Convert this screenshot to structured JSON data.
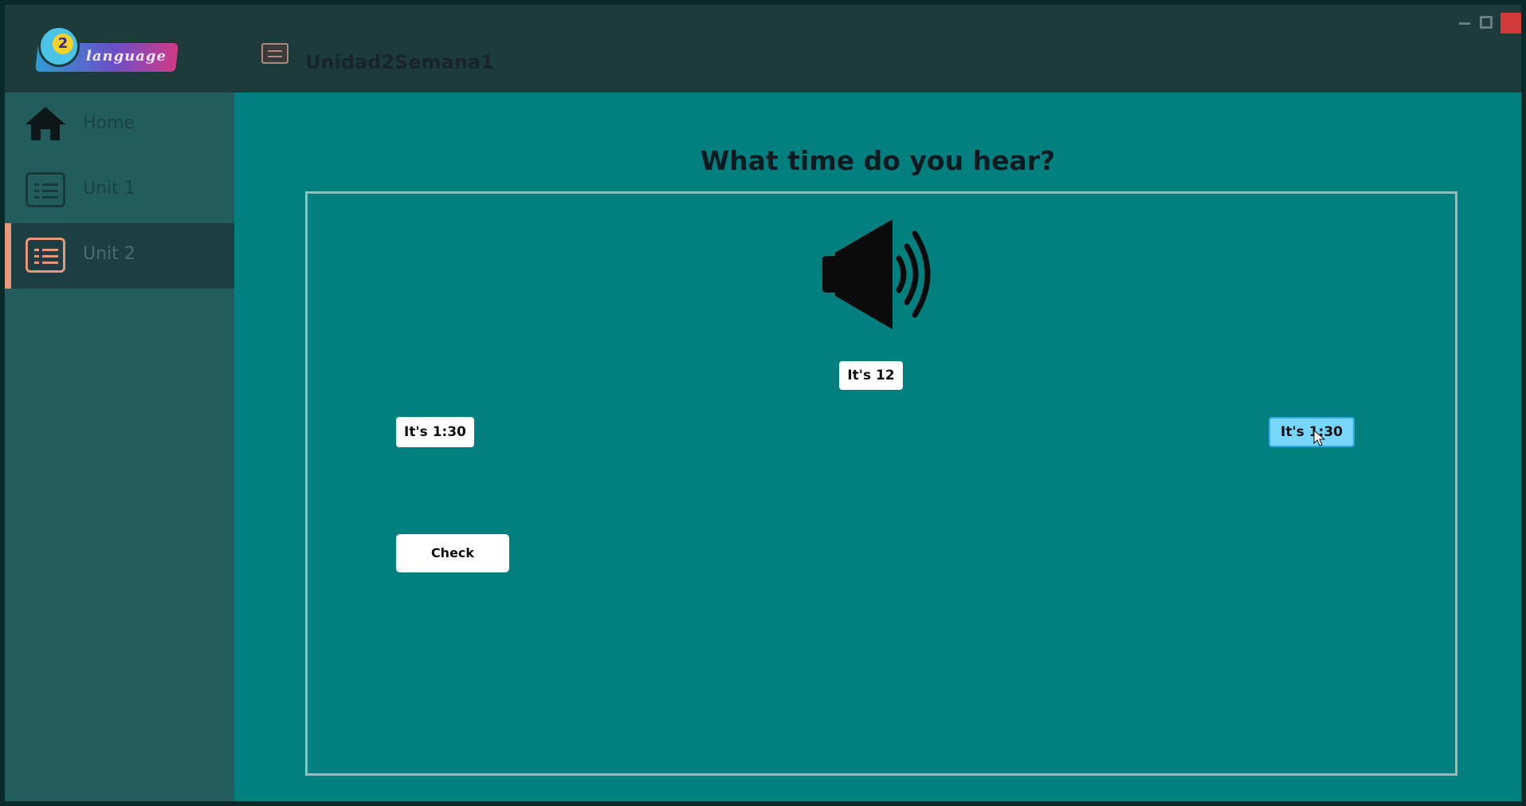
{
  "app": {
    "logo_number": "2",
    "logo_text": "language"
  },
  "header": {
    "title": "Unidad2Semana1",
    "doc_icon": "document-icon"
  },
  "window_controls": [
    "minimize",
    "maximize",
    "close"
  ],
  "sidebar": {
    "items": [
      {
        "label": "Home",
        "icon": "home-icon",
        "active": false
      },
      {
        "label": "Unit 1",
        "icon": "list-icon",
        "active": false
      },
      {
        "label": "Unit 2",
        "icon": "list-icon",
        "active": true
      }
    ]
  },
  "exercise": {
    "question": "What time do you hear?",
    "audio_icon": "speaker-icon",
    "options": [
      {
        "label": "It's 12",
        "selected": false
      },
      {
        "label": "It's 1:30",
        "selected": false
      },
      {
        "label": "It's 1:30",
        "selected": true
      }
    ],
    "check_label": "Check"
  },
  "colors": {
    "background": "#028080",
    "header": "#1d3b3b",
    "sidebar": "#225c5c",
    "accent": "#e9967a",
    "selected_option": "#79d6fb"
  }
}
